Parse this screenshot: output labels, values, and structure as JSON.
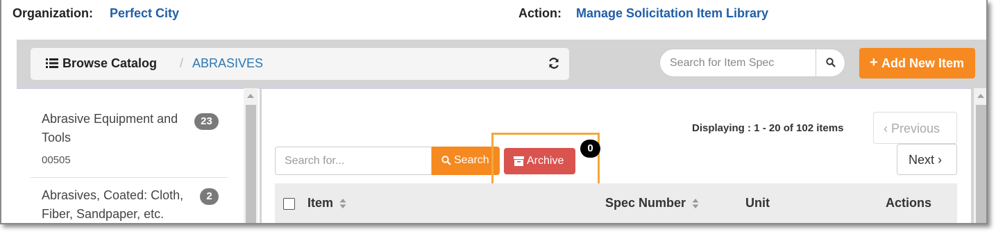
{
  "header": {
    "organization_label": "Organization:",
    "organization_value": "Perfect City",
    "action_label": "Action:",
    "action_value": "Manage Solicitation Item Library"
  },
  "breadcrumb": {
    "icon": "list-icon",
    "title": "Browse Catalog",
    "separator": "/",
    "current": "ABRASIVES",
    "refresh_icon": "refresh-icon"
  },
  "spec_search": {
    "placeholder": "Search for Item Spec",
    "icon": "search-icon"
  },
  "add_button": {
    "icon": "plus-icon",
    "label": "Add New Item"
  },
  "sidebar": {
    "items": [
      {
        "name": "Abrasive Equipment and Tools",
        "count": "23",
        "code": "00505"
      },
      {
        "name": "Abrasives, Coated: Cloth, Fiber, Sandpaper, etc.",
        "count": "2"
      }
    ]
  },
  "main": {
    "display_count": "Displaying : 1 - 20 of 102 items",
    "previous_label": "‹ Previous",
    "next_label": "Next ›",
    "search_placeholder": "Search for...",
    "search_button_label": "Search",
    "archive_button_label": "Archive",
    "archive_count": "0",
    "table_headers": {
      "item": "Item",
      "spec_number": "Spec Number",
      "unit": "Unit",
      "actions": "Actions"
    }
  },
  "colors": {
    "link_blue": "#1f5ea8",
    "orange": "#f6891f",
    "red": "#d9534f",
    "highlight": "#f2a93b",
    "badge_gray": "#7a7a7a"
  }
}
